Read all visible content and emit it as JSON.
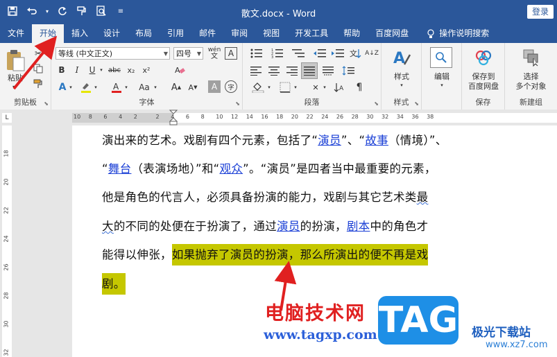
{
  "window": {
    "title": "散文.docx  -  Word",
    "login_label": "登录"
  },
  "qat": [
    "save-icon",
    "undo-icon",
    "redo-icon",
    "format-painter-icon",
    "print-preview-icon",
    "customize-icon"
  ],
  "tabs": [
    "文件",
    "开始",
    "插入",
    "设计",
    "布局",
    "引用",
    "邮件",
    "审阅",
    "视图",
    "开发工具",
    "帮助",
    "百度网盘"
  ],
  "active_tab": "开始",
  "search_label": "操作说明搜索",
  "ribbon": {
    "clipboard": {
      "label": "剪贴板",
      "paste": "粘贴"
    },
    "font": {
      "label": "字体",
      "font_name": "等线 (中文正文)",
      "font_size": "四号",
      "wen": "wén",
      "a_label": "A"
    },
    "paragraph": {
      "label": "段落"
    },
    "styles": {
      "label": "样式",
      "button": "样式"
    },
    "editing": {
      "label": "编辑",
      "button": "编辑"
    },
    "save": {
      "label": "保存",
      "button_line1": "保存到",
      "button_line2": "百度网盘"
    },
    "new_group": {
      "label": "新建组",
      "button_line1": "选择",
      "button_line2": "多个对象"
    }
  },
  "ruler": {
    "h_numbers": [
      "10",
      "8",
      "6",
      "4",
      "2",
      "2",
      "4",
      "6",
      "8",
      "10",
      "12",
      "14",
      "16",
      "18",
      "20",
      "22",
      "24",
      "26",
      "28",
      "30",
      "32",
      "34",
      "36",
      "38"
    ],
    "v_numbers": [
      "18",
      "20",
      "22",
      "24",
      "26",
      "28",
      "30",
      "32"
    ]
  },
  "document": {
    "line1": {
      "a": "演出来的艺术。戏剧有四个元素，包括了“",
      "link1": "演员",
      "b": "”、“",
      "link2": "故事",
      "c": "（情境）”、"
    },
    "line2": {
      "a": "“",
      "link1": "舞台",
      "b": "（表演场地）”和“",
      "link2": "观众",
      "c": "”。“演员”是四者当中最重要的元素，"
    },
    "line3": {
      "a": "他是角色的代言人，必须具备扮演的能力，戏剧与其它艺术类",
      "squig": "最"
    },
    "line4": {
      "squig": "大",
      "a": "的不同的处便在于扮演了，通过",
      "link1": "演员",
      "b": "的扮演，",
      "link2": "剧本",
      "c": "中的角色才"
    },
    "line5": {
      "a": "能得以伸张，",
      "hl": "如果抛弃了演员的扮演，那么所演出的便不再是戏"
    },
    "line6": {
      "hl": "剧。"
    }
  },
  "watermark": {
    "cn": "电脑技术网",
    "url": "www.tagxp.com",
    "logo": "TAG",
    "site_name": "极光下载站",
    "site_url": "www.xz7.com"
  },
  "colors": {
    "brand": "#2b579a",
    "highlight": "#c5c700",
    "link": "#1a3fd6",
    "arrow": "#e02020",
    "tag": "#1e8fe6"
  }
}
